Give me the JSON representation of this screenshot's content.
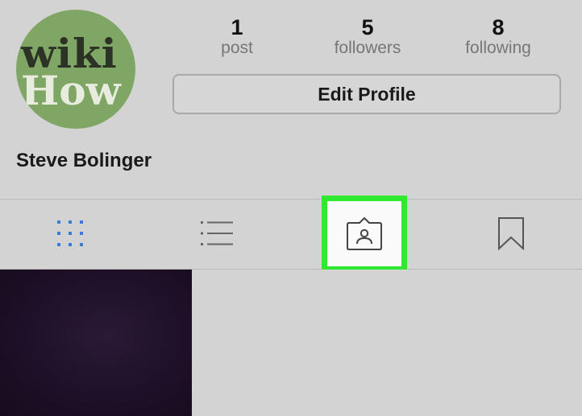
{
  "profile": {
    "avatar_text_line1": "wiki",
    "avatar_text_line2": "How",
    "username": "Steve Bolinger",
    "edit_button_label": "Edit Profile"
  },
  "stats": {
    "posts": {
      "count": "1",
      "label": "post"
    },
    "followers": {
      "count": "5",
      "label": "followers"
    },
    "following": {
      "count": "8",
      "label": "following"
    }
  },
  "tabs": [
    {
      "icon": "grid-icon",
      "active": true
    },
    {
      "icon": "list-icon",
      "active": false
    },
    {
      "icon": "tagged-photos-icon",
      "active": false,
      "highlighted": true
    },
    {
      "icon": "bookmark-icon",
      "active": false
    }
  ],
  "colors": {
    "background": "#d3d3d3",
    "active_tab": "#3a7bd5",
    "highlight_border": "#2fe82f",
    "avatar_bg": "#7fa665"
  }
}
